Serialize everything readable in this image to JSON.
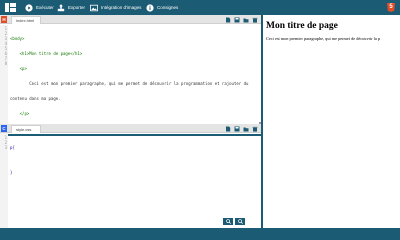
{
  "toolbar": {
    "execute_label": "Exécuter",
    "export_label": "Exporter",
    "images_label": "Intégration d'images",
    "instructions_label": "Consignes",
    "html5_badge": "5"
  },
  "html_pane": {
    "lang_label": "H",
    "tab_label": "index.html",
    "line_numbers": [
      "1",
      "2",
      "3",
      "4",
      "5",
      "6",
      "7",
      "8"
    ],
    "lines": [
      "<body>",
      "    <h1>Mon titre de page</h1>",
      "    <p>",
      "        Ceci est mon premier paragraphe, qui me permet de découvrir la programmation et rajouter du",
      "contenu dans ma page.",
      "    </p>",
      "</body>",
      ""
    ]
  },
  "css_pane": {
    "lang_label": "C",
    "tab_label": "style.css",
    "line_numbers": [
      "1",
      "2",
      "3"
    ],
    "lines": [
      "p{",
      "",
      "}"
    ]
  },
  "preview": {
    "heading": "Mon titre de page",
    "paragraph": "Ceci est mon premier paragraphe, qui me permet de découvrir la p"
  },
  "colors": {
    "primary": "#1b5b73",
    "html_orange": "#e34c26",
    "css_blue": "#2965f1"
  },
  "icons": [
    "grid-logo-icon",
    "play-icon",
    "export-icon",
    "image-icon",
    "info-icon",
    "new-file-icon",
    "save-icon",
    "open-folder-icon",
    "trash-icon",
    "zoom-in-icon",
    "zoom-out-icon"
  ]
}
